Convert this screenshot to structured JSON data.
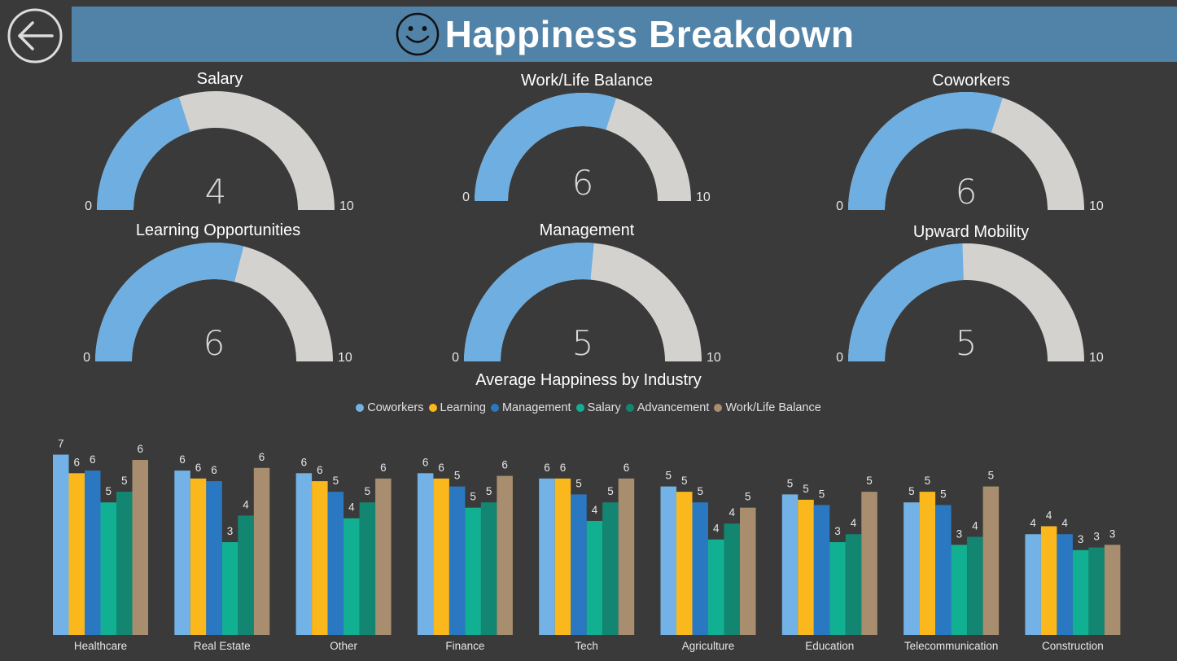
{
  "header": {
    "title": "Happiness Breakdown",
    "back_icon": "back-arrow-icon",
    "smiley_icon": "smiley-icon",
    "background_color": "#5182a8"
  },
  "gauges": [
    {
      "title": "Salary",
      "value": "4",
      "min_label": "0",
      "max_label": "10",
      "fraction": 0.4
    },
    {
      "title": "Work/Life Balance",
      "value": "6",
      "min_label": "0",
      "max_label": "10",
      "fraction": 0.6
    },
    {
      "title": "Coworkers",
      "value": "6",
      "min_label": "0",
      "max_label": "10",
      "fraction": 0.6
    },
    {
      "title": "Learning Opportunities",
      "value": "6",
      "min_label": "0",
      "max_label": "10",
      "fraction": 0.58
    },
    {
      "title": "Management",
      "value": "5",
      "min_label": "0",
      "max_label": "10",
      "fraction": 0.53
    },
    {
      "title": "Upward Mobility",
      "value": "5",
      "min_label": "0",
      "max_label": "10",
      "fraction": 0.49
    }
  ],
  "gauge_colors": {
    "fill": "#6eaee0",
    "track": "#d4d2cf"
  },
  "chart_data": {
    "type": "bar",
    "title": "Average Happiness by Industry",
    "categories": [
      "Healthcare",
      "Real Estate",
      "Other",
      "Finance",
      "Tech",
      "Agriculture",
      "Education",
      "Telecommunication",
      "Construction"
    ],
    "series": [
      {
        "name": "Coworkers",
        "color": "#73b2e6",
        "values": [
          6.8,
          6.2,
          6.1,
          6.1,
          5.9,
          5.6,
          5.3,
          5.0,
          3.8
        ],
        "labels": [
          "7",
          "6",
          "6",
          "6",
          "6",
          "5",
          "5",
          "5",
          "4"
        ]
      },
      {
        "name": "Learning",
        "color": "#fbb81c",
        "values": [
          6.1,
          5.9,
          5.8,
          5.9,
          5.9,
          5.4,
          5.1,
          5.4,
          4.1
        ],
        "labels": [
          "6",
          "6",
          "6",
          "6",
          "6",
          "5",
          "5",
          "5",
          "4"
        ]
      },
      {
        "name": "Management",
        "color": "#2b78c2",
        "values": [
          6.2,
          5.8,
          5.4,
          5.6,
          5.3,
          5.0,
          4.9,
          4.9,
          3.8
        ],
        "labels": [
          "6",
          "6",
          "5",
          "5",
          "5",
          "5",
          "5",
          "5",
          "4"
        ]
      },
      {
        "name": "Salary",
        "color": "#12b093",
        "values": [
          5.0,
          3.5,
          4.4,
          4.8,
          4.3,
          3.6,
          3.5,
          3.4,
          3.2
        ],
        "labels": [
          "5",
          "3",
          "4",
          "5",
          "4",
          "4",
          "3",
          "3",
          "3"
        ]
      },
      {
        "name": "Advancement",
        "color": "#128670",
        "values": [
          5.4,
          4.5,
          5.0,
          5.0,
          5.0,
          4.2,
          3.8,
          3.7,
          3.3
        ],
        "labels": [
          "5",
          "4",
          "5",
          "5",
          "5",
          "4",
          "4",
          "4",
          "3"
        ]
      },
      {
        "name": "Work/Life Balance",
        "color": "#a88e6f",
        "values": [
          6.6,
          6.3,
          5.9,
          6.0,
          5.9,
          4.8,
          5.4,
          5.6,
          3.4
        ],
        "labels": [
          "6",
          "6",
          "6",
          "6",
          "6",
          "5",
          "5",
          "5",
          "3"
        ]
      }
    ],
    "legend_position": "top-center",
    "grid": false,
    "ylim": [
      0,
      7.5
    ]
  }
}
